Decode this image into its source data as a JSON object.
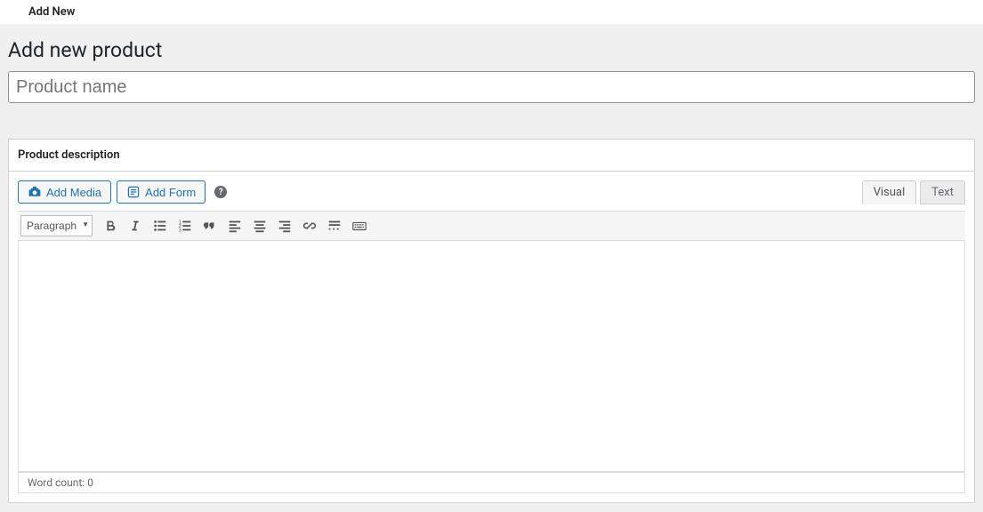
{
  "topbar": {
    "label": "Add New"
  },
  "page": {
    "title": "Add new product"
  },
  "product_name": {
    "placeholder": "Product name",
    "value": ""
  },
  "editor": {
    "header": "Product description",
    "add_media": "Add Media",
    "add_form": "Add Form",
    "help": "?",
    "tabs": {
      "visual": "Visual",
      "text": "Text"
    },
    "format_selected": "Paragraph",
    "word_count_label": "Word count: ",
    "word_count": 0
  }
}
